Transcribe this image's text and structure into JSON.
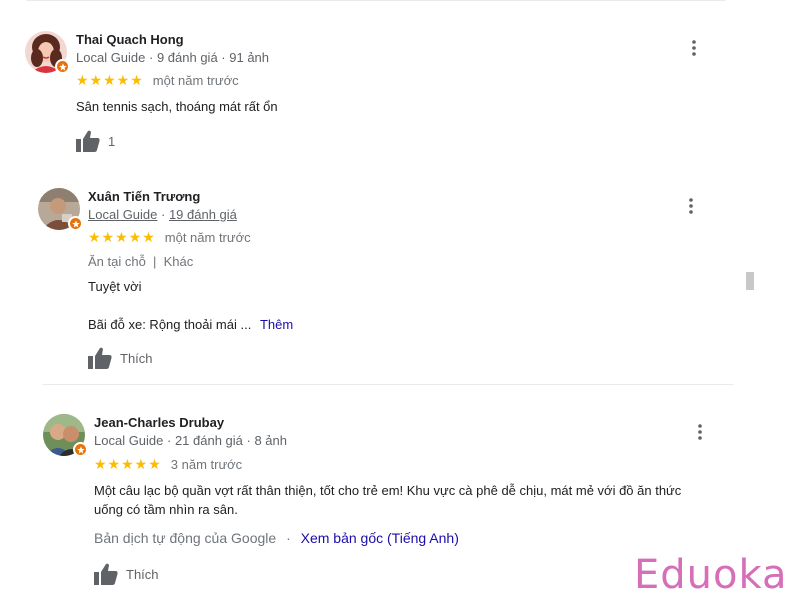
{
  "reviews": [
    {
      "name": "Thai Quach Hong",
      "guide": "Local Guide",
      "sep1": " · ",
      "reviews_count": "9 đánh giá",
      "sep2": " · ",
      "photos_count": "91 ảnh",
      "stars": "★★★★★",
      "time": "một năm trước",
      "text": "Sân tennis sạch, thoáng mát rất ổn",
      "like_count": "1"
    },
    {
      "name": "Xuân Tiến Trương",
      "guide": "Local Guide",
      "sep1": " · ",
      "reviews_count": "19 đánh giá",
      "stars": "★★★★★",
      "time": "một năm trước",
      "tags": "Ăn tại chỗ  |  Khác",
      "text": "Tuyệt vời",
      "parking": "Bãi đỗ xe: Rộng thoải mái ...",
      "more_label": "Thêm",
      "like_label": "Thích"
    },
    {
      "name": "Jean-Charles Drubay",
      "guide": "Local Guide",
      "sep1": " · ",
      "reviews_count": "21 đánh giá",
      "sep2": " · ",
      "photos_count": "8 ảnh",
      "stars": "★★★★★",
      "time": "3 năm trước",
      "text_line1": "Một câu lạc bộ quần vợt rất thân thiện, tốt cho trẻ em! Khu vực cà phê dễ chịu, mát mẻ với đồ ăn thức",
      "text_line2": "uống có tầm nhìn ra sân.",
      "translation": "Bản dịch tự động của Google",
      "translation_sep": "·",
      "original_link": "Xem bản gốc (Tiếng Anh)",
      "like_label": "Thích"
    }
  ],
  "watermark": "Eduoka",
  "colors": {
    "star": "#fbbc04",
    "badge": "#e8710a",
    "link": "#1a0dab",
    "watermark": "#d66fb8"
  }
}
